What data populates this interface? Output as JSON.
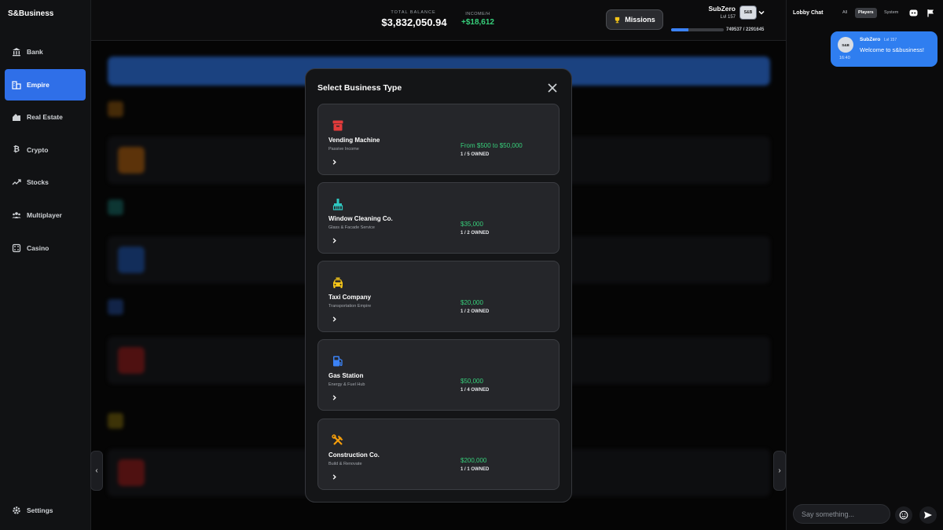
{
  "brand": "S&Business",
  "sidebar": {
    "items": [
      {
        "label": "Bank",
        "icon": "bank-icon"
      },
      {
        "label": "Empire",
        "icon": "empire-icon",
        "active": true
      },
      {
        "label": "Real Estate",
        "icon": "real-estate-icon"
      },
      {
        "label": "Crypto",
        "icon": "bitcoin-icon"
      },
      {
        "label": "Stocks",
        "icon": "trend-icon"
      },
      {
        "label": "Multiplayer",
        "icon": "users-icon"
      },
      {
        "label": "Casino",
        "icon": "dice-icon"
      }
    ],
    "settings_label": "Settings"
  },
  "topbar": {
    "balance_label": "TOTAL BALANCE",
    "balance_value": "$3,832,050.94",
    "income_label": "INCOME/H",
    "income_value": "+$18,612",
    "missions_label": "Missions",
    "user_name": "SubZero",
    "user_level": "Lvl 157",
    "xp_text": "749537 / 2291645",
    "xp_fraction": 0.327
  },
  "modal": {
    "title": "Select Business Type",
    "options": [
      {
        "name": "Vending Machine",
        "desc": "Passive Income",
        "price": "From $500 to $50,000",
        "owned": "1 / 5 OWNED",
        "icon": "vending-icon",
        "color": "#e23b3b"
      },
      {
        "name": "Window Cleaning Co.",
        "desc": "Glass & Facade Service",
        "price": "$35,000",
        "owned": "1 / 2 OWNED",
        "icon": "brush-icon",
        "color": "#2fc7c0"
      },
      {
        "name": "Taxi Company",
        "desc": "Transportation Empire",
        "price": "$20,000",
        "owned": "1 / 2 OWNED",
        "icon": "taxi-icon",
        "color": "#f5c518"
      },
      {
        "name": "Gas Station",
        "desc": "Energy & Fuel Hub",
        "price": "$50,000",
        "owned": "1 / 4 OWNED",
        "icon": "fuel-icon",
        "color": "#3b82f6"
      },
      {
        "name": "Construction Co.",
        "desc": "Build & Renovate",
        "price": "$200,000",
        "owned": "1 / 1 OWNED",
        "icon": "tools-icon",
        "color": "#f59e0b"
      }
    ]
  },
  "chat": {
    "title": "Lobby Chat",
    "tabs": [
      "All",
      "Players",
      "System"
    ],
    "active_tab": "Players",
    "message": {
      "user": "SubZero",
      "level": "Lvl 157",
      "text": "Welcome to s&business!",
      "time": "16:40"
    },
    "input_placeholder": "Say something..."
  },
  "colors": {
    "accent": "#2f6fe8",
    "income": "#37d07b",
    "bubble": "#2f7ef0"
  }
}
